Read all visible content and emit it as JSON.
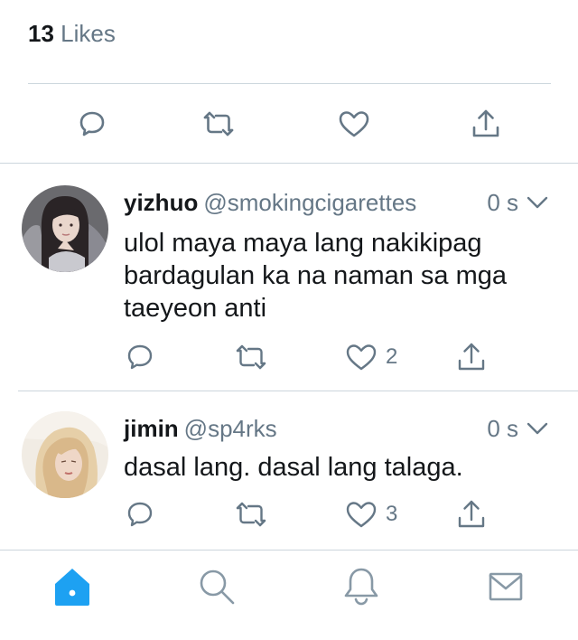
{
  "tweet_stats": {
    "likes_count": "13",
    "likes_label": "Likes"
  },
  "main_actions": [
    "reply-icon",
    "retweet-icon",
    "like-icon",
    "share-icon"
  ],
  "replies": [
    {
      "display_name": "yizhuo",
      "handle": "@smokingcigarettes",
      "time": "0 s",
      "text": "ulol maya maya lang nakikipag bardagulan ka na naman sa mga taeyeon anti",
      "reply_count": "",
      "retweet_count": "",
      "like_count": "2"
    },
    {
      "display_name": "jimin",
      "handle": "@sp4rks",
      "time": "0 s",
      "text": "dasal lang. dasal lang talaga.",
      "reply_count": "",
      "retweet_count": "",
      "like_count": "3"
    }
  ],
  "tab_bar": {
    "items": [
      "home-icon",
      "search-icon",
      "notifications-icon",
      "messages-icon"
    ],
    "active": "home",
    "active_color": "#1da1f2"
  },
  "colors": {
    "accent": "#1da1f2",
    "secondary_text": "#657786",
    "divider": "#ccd6dd"
  }
}
